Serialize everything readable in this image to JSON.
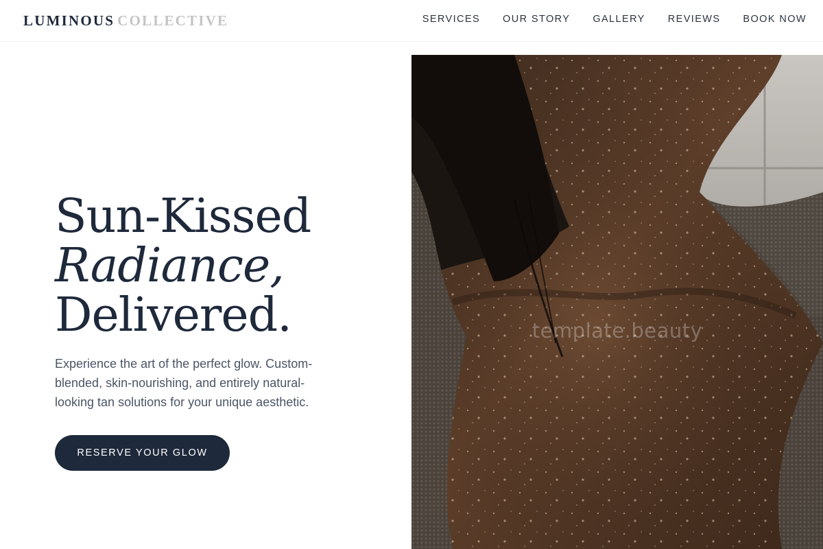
{
  "brand": {
    "part1": "LUMINOUS",
    "part2": "COLLECTIVE"
  },
  "nav": {
    "items": [
      {
        "label": "SERVICES"
      },
      {
        "label": "OUR STORY"
      },
      {
        "label": "GALLERY"
      },
      {
        "label": "REVIEWS"
      },
      {
        "label": "BOOK NOW"
      }
    ]
  },
  "hero": {
    "headline_line1": "Sun-Kissed",
    "headline_line2": "Radiance,",
    "headline_line3": "Delivered.",
    "subtext": "Experience the art of the perfect glow. Custom-blended, skin-nourishing, and entirely natural-looking tan solutions for your unique aesthetic.",
    "cta_label": "RESERVE YOUR GLOW",
    "image_watermark": "template.beauty"
  },
  "colors": {
    "primary": "#1e293b",
    "brand_muted": "#c4c4c4",
    "text_muted": "#4b5565",
    "background": "#ffffff"
  }
}
